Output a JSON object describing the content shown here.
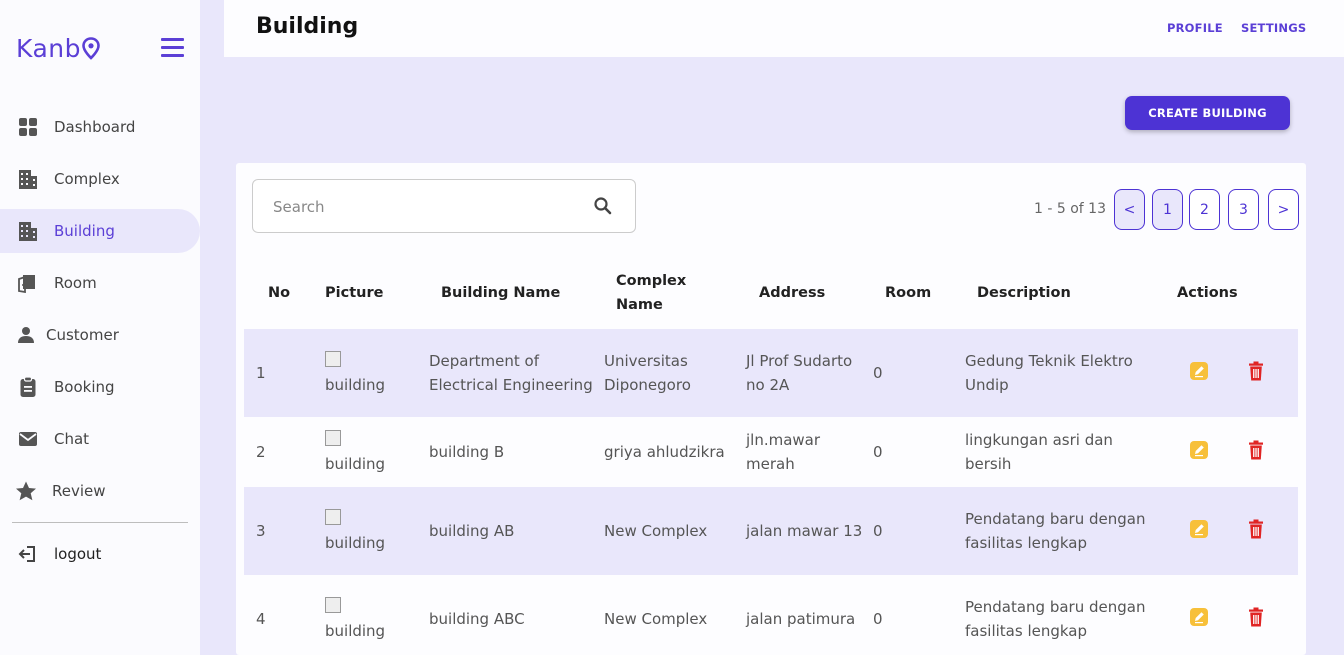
{
  "brand": {
    "name": "Kanb"
  },
  "colors": {
    "accent": "#4d33d4",
    "edit": "#f7c03a",
    "delete": "#e02424",
    "row_tint": "#e9e7fb"
  },
  "sidebar": {
    "items": [
      {
        "label": "Dashboard",
        "icon": "dashboard-icon"
      },
      {
        "label": "Complex",
        "icon": "building-icon"
      },
      {
        "label": "Building",
        "icon": "building-icon",
        "active": true
      },
      {
        "label": "Room",
        "icon": "door-icon"
      },
      {
        "label": "Customer",
        "icon": "person-icon"
      },
      {
        "label": "Booking",
        "icon": "clipboard-icon"
      },
      {
        "label": "Chat",
        "icon": "mail-icon"
      },
      {
        "label": "Review",
        "icon": "star-icon"
      }
    ],
    "logout": {
      "label": "logout",
      "icon": "logout-icon"
    }
  },
  "header": {
    "title": "Building",
    "profile": "PROFILE",
    "settings": "SETTINGS"
  },
  "toolbar": {
    "create_label": "CREATE BUILDING"
  },
  "search": {
    "placeholder": "Search"
  },
  "pagination": {
    "info": "1 - 5 of 13",
    "prev": "<",
    "next": ">",
    "pages": [
      "1",
      "2",
      "3"
    ],
    "current": "1"
  },
  "table": {
    "headers": [
      "No",
      "Picture",
      "Building Name",
      "Complex Name",
      "Address",
      "Room",
      "Description",
      "Actions"
    ],
    "rows": [
      {
        "no": "1",
        "picture_alt": "building",
        "name": "Department of Electrical Engineering",
        "complex": "Universitas Diponegoro",
        "address": "Jl Prof Sudarto no 2A",
        "room": "0",
        "description": "Gedung Teknik Elektro Undip"
      },
      {
        "no": "2",
        "picture_alt": "building",
        "name": "building B",
        "complex": "griya ahludzikra",
        "address": "jln.mawar merah",
        "room": "0",
        "description": "lingkungan asri dan bersih"
      },
      {
        "no": "3",
        "picture_alt": "building",
        "name": "building AB",
        "complex": "New Complex",
        "address": "jalan mawar 13",
        "room": "0",
        "description": "Pendatang baru dengan fasilitas lengkap"
      },
      {
        "no": "4",
        "picture_alt": "building",
        "name": "building ABC",
        "complex": "New Complex",
        "address": "jalan patimura",
        "room": "0",
        "description": "Pendatang baru dengan fasilitas lengkap"
      }
    ]
  }
}
